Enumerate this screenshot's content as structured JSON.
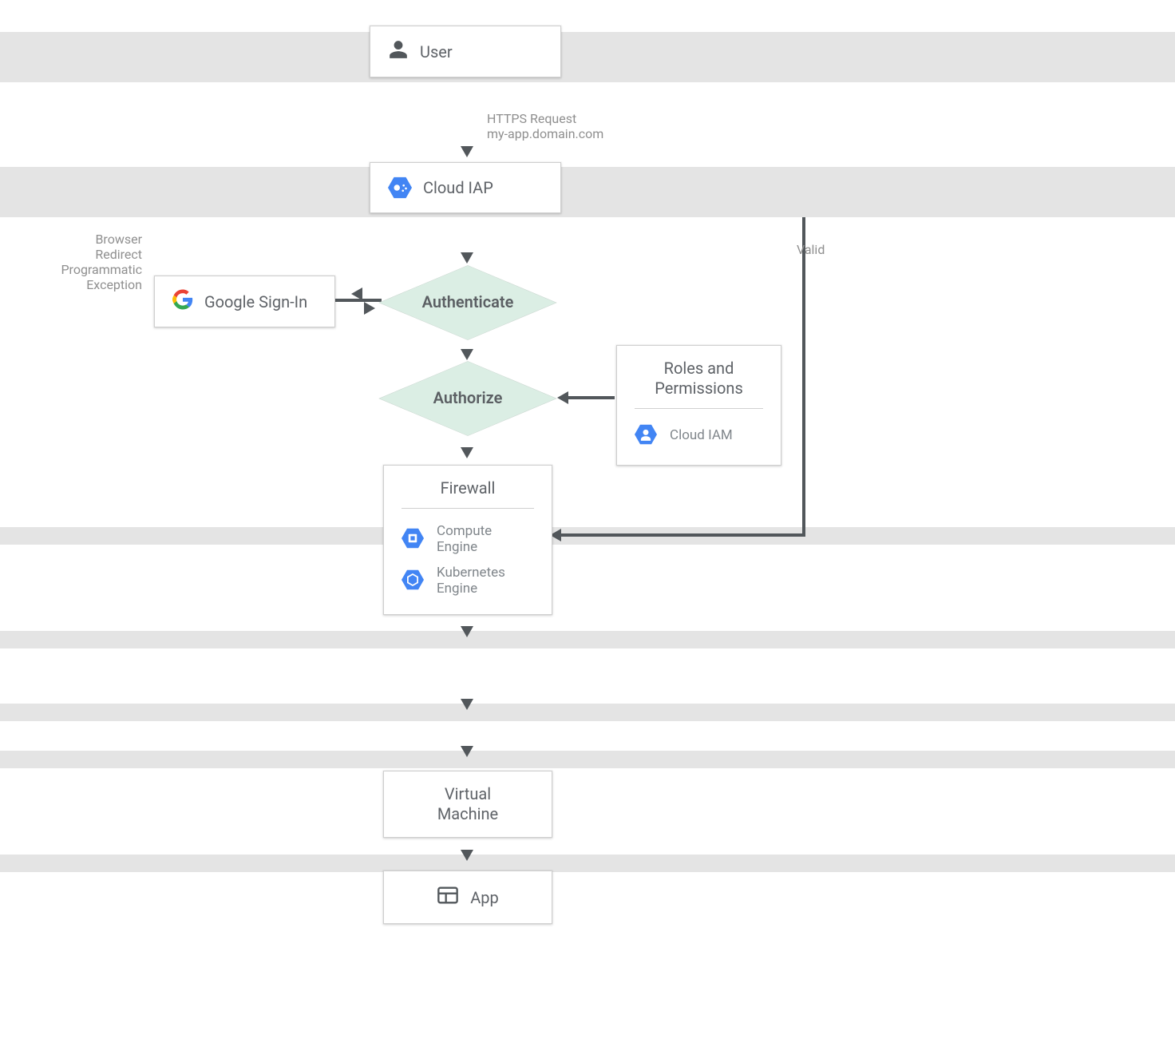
{
  "nodes": {
    "user": "User",
    "cloud_iap": "Cloud IAP",
    "google_signin": "Google Sign-In",
    "authenticate": "Authenticate",
    "authorize": "Authorize",
    "roles_perm_title": "Roles and Permissions",
    "cloud_iam": "Cloud IAM",
    "firewall_title": "Firewall",
    "compute_engine": "Compute Engine",
    "kubernetes_engine": "Kubernetes Engine",
    "vm_title_l1": "Virtual",
    "vm_title_l2": "Machine",
    "app": "App"
  },
  "notes": {
    "https_l1": "HTTPS Request",
    "https_l2": "my-app.domain.com",
    "redirect_l1": "Browser",
    "redirect_l2": "Redirect",
    "redirect_l3": "Programmatic",
    "redirect_l4": "Exception",
    "valid": "Valid"
  },
  "colors": {
    "band": "#e4e4e4",
    "diamond": "#dbeee4",
    "arrow": "#52575b",
    "gcp_blue": "#4285f4"
  }
}
